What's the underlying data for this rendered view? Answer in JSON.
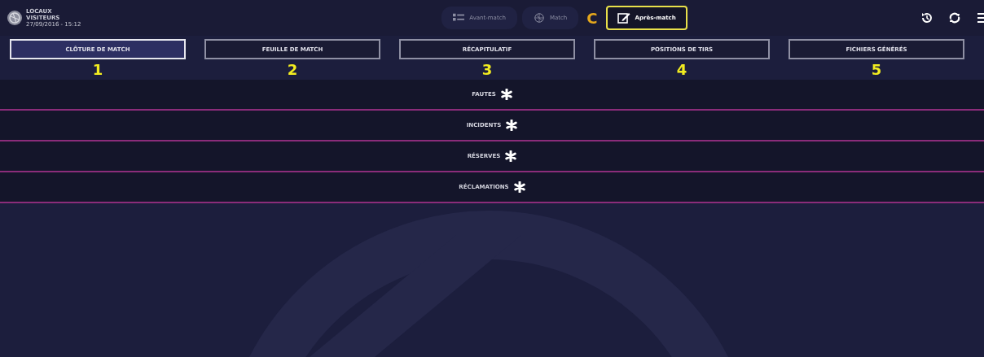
{
  "header": {
    "teams": [
      "LOCAUX",
      "VISITEURS"
    ],
    "datetime": "27/09/2016 - 15:12"
  },
  "nav": [
    {
      "label": "Avant-match",
      "kind": "list",
      "selected": false
    },
    {
      "label": "Match",
      "kind": "ball",
      "selected": false
    },
    {
      "label": "Après-match",
      "kind": "edit",
      "selected": true
    }
  ],
  "nav_annotation": "C",
  "tabs": [
    {
      "label": "CLÔTURE DE MATCH",
      "selected": true,
      "annotation": "1"
    },
    {
      "label": "FEUILLE DE MATCH",
      "selected": false,
      "annotation": "2"
    },
    {
      "label": "RÉCAPITULATIF",
      "selected": false,
      "annotation": "3"
    },
    {
      "label": "POSITIONS DE TIRS",
      "selected": false,
      "annotation": "4"
    },
    {
      "label": "FICHIERS GÉNÉRÉS",
      "selected": false,
      "annotation": "5"
    }
  ],
  "sections": [
    {
      "label": "FAUTES",
      "required": true
    },
    {
      "label": "INCIDENTS",
      "required": true
    },
    {
      "label": "RÉSERVES",
      "required": true
    },
    {
      "label": "RÉCLAMATIONS",
      "required": true
    }
  ]
}
